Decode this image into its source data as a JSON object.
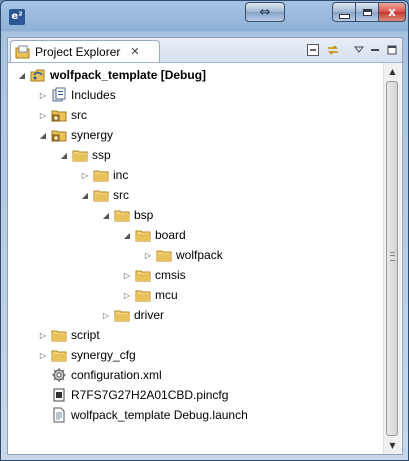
{
  "window": {
    "app_logo": "e²",
    "close_glyph": "x"
  },
  "tab": {
    "label": "Project Explorer",
    "close_glyph": "✕"
  },
  "tree": [
    {
      "label": "wolfpack_template [Debug]",
      "depth": 0,
      "state": "expanded",
      "icon": "project-icon",
      "bold": true,
      "selected": true
    },
    {
      "label": "Includes",
      "depth": 1,
      "state": "collapsed",
      "icon": "includes-icon"
    },
    {
      "label": "src",
      "depth": 1,
      "state": "collapsed",
      "icon": "source-folder-icon"
    },
    {
      "label": "synergy",
      "depth": 1,
      "state": "expanded",
      "icon": "source-folder-icon"
    },
    {
      "label": "ssp",
      "depth": 2,
      "state": "expanded",
      "icon": "folder-icon"
    },
    {
      "label": "inc",
      "depth": 3,
      "state": "collapsed",
      "icon": "folder-icon"
    },
    {
      "label": "src",
      "depth": 3,
      "state": "expanded",
      "icon": "folder-icon"
    },
    {
      "label": "bsp",
      "depth": 4,
      "state": "expanded",
      "icon": "folder-icon"
    },
    {
      "label": "board",
      "depth": 5,
      "state": "expanded",
      "icon": "folder-icon"
    },
    {
      "label": "wolfpack",
      "depth": 6,
      "state": "collapsed",
      "icon": "folder-icon"
    },
    {
      "label": "cmsis",
      "depth": 5,
      "state": "collapsed",
      "icon": "folder-icon"
    },
    {
      "label": "mcu",
      "depth": 5,
      "state": "collapsed",
      "icon": "folder-icon"
    },
    {
      "label": "driver",
      "depth": 4,
      "state": "collapsed",
      "icon": "folder-icon"
    },
    {
      "label": "script",
      "depth": 1,
      "state": "collapsed",
      "icon": "folder-icon"
    },
    {
      "label": "synergy_cfg",
      "depth": 1,
      "state": "collapsed",
      "icon": "folder-icon"
    },
    {
      "label": "configuration.xml",
      "depth": 1,
      "state": "leaf",
      "icon": "gear-file-icon"
    },
    {
      "label": "R7FS7G27H2A01CBD.pincfg",
      "depth": 1,
      "state": "leaf",
      "icon": "pincfg-file-icon"
    },
    {
      "label": "wolfpack_template Debug.launch",
      "depth": 1,
      "state": "leaf",
      "icon": "launch-file-icon"
    }
  ],
  "colors": {
    "folder": "#e8c15a",
    "selection": "#ffffff",
    "accent": "#2b5797"
  }
}
